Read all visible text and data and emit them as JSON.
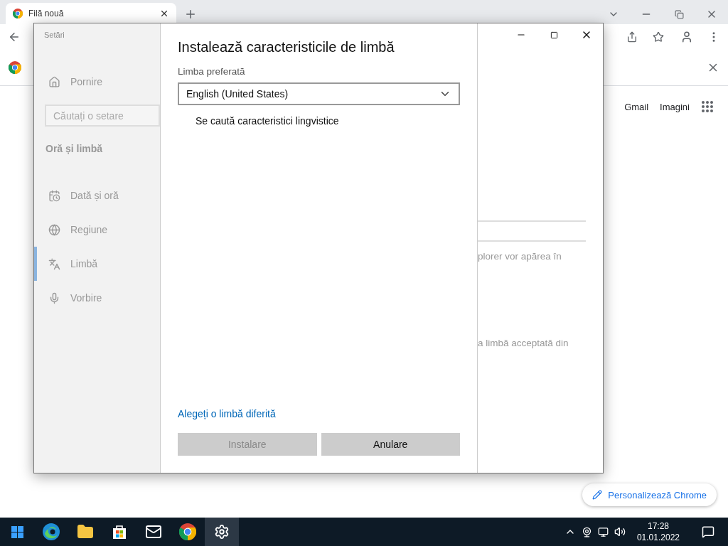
{
  "browser": {
    "tabs": [
      {
        "title": "Filă nouă",
        "selected": true
      }
    ],
    "links": [
      "Gmail",
      "Imagini"
    ],
    "customize_button": "Personalizează Chrome"
  },
  "settings_window": {
    "title": "Setări",
    "home": "Pornire",
    "search": {
      "placeholder": "Căutați o setare"
    },
    "section": "Oră și limbă",
    "nav_items": [
      {
        "kind": "calendar",
        "label": "Dată și oră",
        "selected": false
      },
      {
        "kind": "globe",
        "label": "Regiune",
        "selected": false
      },
      {
        "kind": "language",
        "label": "Limbă",
        "selected": true
      },
      {
        "kind": "mic",
        "label": "Vorbire",
        "selected": false
      }
    ],
    "background_texts": [
      "plorer vor apărea în",
      "a limbă acceptată din"
    ],
    "dialog": {
      "title": "Instalează caracteristicile de limbă",
      "dropdown_label": "Limba preferată",
      "dropdown_value": "English (United States)",
      "status": "Se caută caracteristici lingvistice",
      "link": "Alegeți o limbă diferită",
      "buttons": [
        {
          "label": "Instalare",
          "disabled": true
        },
        {
          "label": "Anulare",
          "disabled": false
        }
      ]
    }
  },
  "taskbar": {
    "apps": [
      {
        "kind": "edge",
        "active": false
      },
      {
        "kind": "explorer",
        "active": false
      },
      {
        "kind": "store",
        "active": false
      },
      {
        "kind": "mail",
        "active": false
      },
      {
        "kind": "chrome",
        "active": false
      },
      {
        "kind": "settings",
        "active": true
      }
    ],
    "time": "17:28",
    "date": "01.01.2022"
  }
}
